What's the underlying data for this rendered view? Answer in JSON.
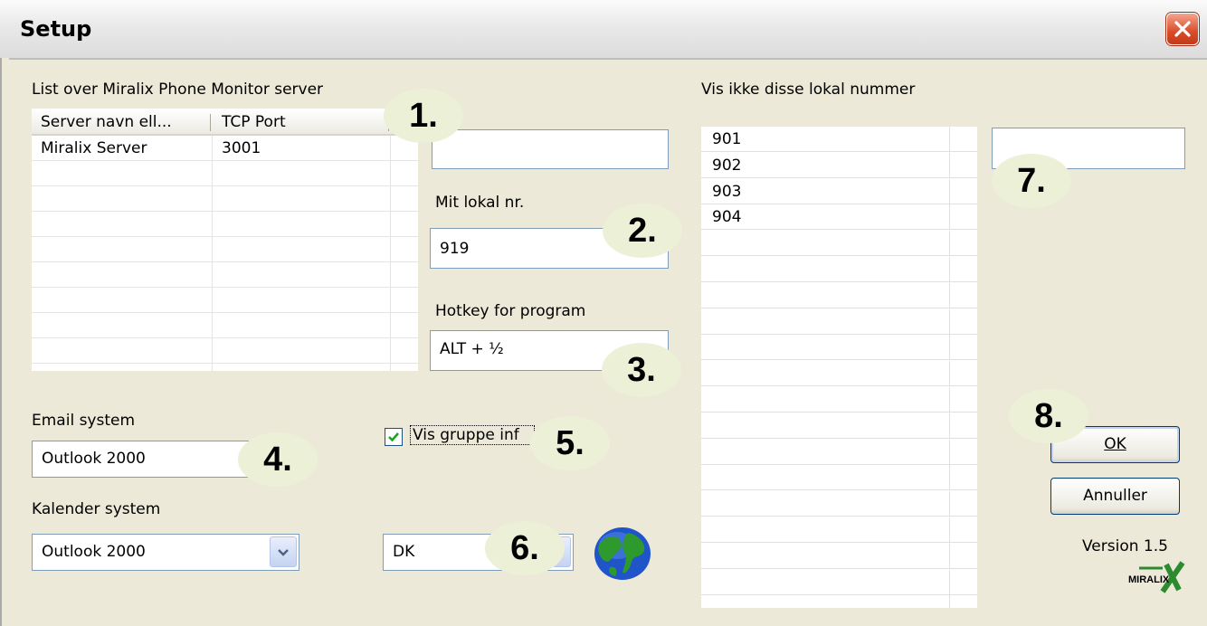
{
  "window": {
    "title": "Setup"
  },
  "server_list": {
    "label": "List over Miralix Phone Monitor server",
    "columns": [
      "Server navn ell...",
      "TCP Port"
    ],
    "rows": [
      {
        "name": "Miralix Server",
        "port": "3001"
      }
    ]
  },
  "server_input": {
    "value": ""
  },
  "local_number": {
    "label": "Mit lokal nr.",
    "value": "919"
  },
  "hotkey": {
    "label": "Hotkey for program",
    "value": "ALT + ½"
  },
  "email": {
    "label": "Email system",
    "value": "Outlook 2000"
  },
  "calendar": {
    "label": "Kalender system",
    "value": "Outlook 2000"
  },
  "group_info": {
    "label": "Vis gruppe inf",
    "checked": true
  },
  "language": {
    "value": "DK"
  },
  "exclude_list": {
    "label": "Vis ikke disse lokal nummer",
    "items": [
      "901",
      "902",
      "903",
      "904"
    ]
  },
  "exclude_input": {
    "value": ""
  },
  "buttons": {
    "ok": "OK",
    "cancel": "Annuller"
  },
  "version": "Version 1.5",
  "logo_text": "MIRALIX",
  "callouts": [
    "1.",
    "2.",
    "3.",
    "4.",
    "5.",
    "6.",
    "7.",
    "8."
  ],
  "icons": {
    "close": "close-icon",
    "dropdown": "chevron-down-icon",
    "globe": "globe-icon",
    "check": "checkmark-icon"
  },
  "colors": {
    "dialog_bg": "#ece9d8",
    "close_red": "#d94c2a",
    "callout_bg": "#ecf0d6",
    "field_border": "#7f9db9"
  }
}
